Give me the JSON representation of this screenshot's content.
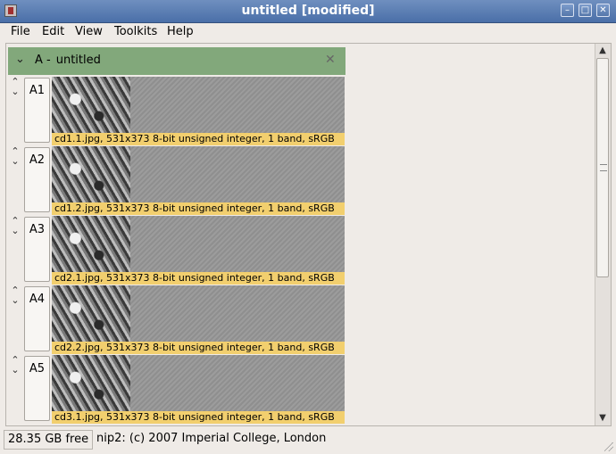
{
  "window": {
    "title": "untitled [modified]",
    "controls": {
      "minimize": "–",
      "maximize": "□",
      "close": "✕"
    }
  },
  "menu": [
    "File",
    "Edit",
    "View",
    "Toolkits",
    "Help"
  ],
  "workspace": {
    "header": {
      "id": "A -",
      "name": "untitled"
    },
    "rows": [
      {
        "label": "A1",
        "caption": "cd1.1.jpg, 531x373 8-bit unsigned integer, 1 band, sRGB"
      },
      {
        "label": "A2",
        "caption": "cd1.2.jpg, 531x373 8-bit unsigned integer, 1 band, sRGB"
      },
      {
        "label": "A3",
        "caption": "cd2.1.jpg, 531x373 8-bit unsigned integer, 1 band, sRGB"
      },
      {
        "label": "A4",
        "caption": "cd2.2.jpg, 531x373 8-bit unsigned integer, 1 band, sRGB"
      },
      {
        "label": "A5",
        "caption": "cd3.1.jpg, 531x373 8-bit unsigned integer, 1 band, sRGB"
      }
    ]
  },
  "status": {
    "free_space": "28.35 GB free",
    "message": "nip2: (c) 2007 Imperial College, London"
  },
  "colors": {
    "titlebar": "#5577aa",
    "header": "#82a87b",
    "caption": "#f2cf6e"
  }
}
